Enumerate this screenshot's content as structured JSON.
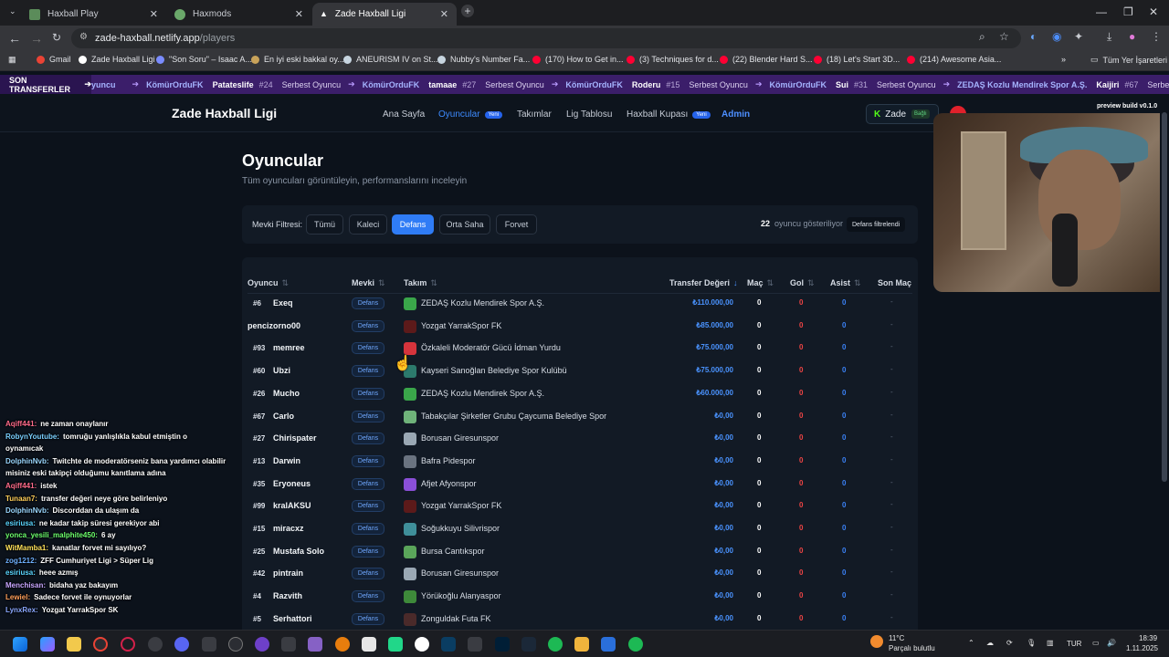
{
  "browser": {
    "tabs": [
      {
        "title": "Haxball Play",
        "active": false
      },
      {
        "title": "Haxmods",
        "active": false
      },
      {
        "title": "Zade Haxball Ligi",
        "active": true
      }
    ],
    "url_host": "zade-haxball.netlify.app",
    "url_path": "/players",
    "bookmarks": [
      "Gmail",
      "Zade Haxball Ligi",
      "\"Son Soru\" – Isaac A...",
      "En iyi eski bakkal oy...",
      "ANEURISM IV on St...",
      "Nubby's Number Fa...",
      "(170) How to Get in...",
      "(3) Techniques for d...",
      "(22) Blender Hard S...",
      "(18) Let's Start 3D...",
      "(214) Awesome Asia..."
    ],
    "all_bookmarks": "Tüm Yer İşaretleri"
  },
  "ticker": {
    "label": "SON TRANSFERLER",
    "items": [
      {
        "from": "",
        "to": "yuncu",
        "player": "",
        "num": ""
      },
      {
        "from": "",
        "to": "KömürOrduFK",
        "player": "Patateslife",
        "num": "#24"
      },
      {
        "from": "Serbest Oyuncu",
        "to": "KömürOrduFK",
        "player": "tamaae",
        "num": "#27"
      },
      {
        "from": "Serbest Oyuncu",
        "to": "KömürOrduFK",
        "player": "Roderu",
        "num": "#15"
      },
      {
        "from": "Serbest Oyuncu",
        "to": "KömürOrduFK",
        "player": "Sui",
        "num": "#31"
      },
      {
        "from": "Serbest Oyuncu",
        "to": "ZEDAŞ Kozlu Mendirek Spor A.Ş.",
        "player": "Kaijiri",
        "num": "#67"
      },
      {
        "from": "Serbest O",
        "to": "",
        "player": "",
        "num": ""
      }
    ]
  },
  "header": {
    "logo": "Zade Haxball Ligi",
    "nav": [
      {
        "label": "Ana Sayfa",
        "badge": ""
      },
      {
        "label": "Oyuncular",
        "badge": "Yeni"
      },
      {
        "label": "Takımlar",
        "badge": ""
      },
      {
        "label": "Lig Tablosu",
        "badge": ""
      },
      {
        "label": "Haxball Kupası",
        "badge": "Yeni"
      },
      {
        "label": "Admin",
        "badge": ""
      }
    ],
    "user": "Zade",
    "user_status": "Bağlı",
    "kick_glyph": "K",
    "preview": "preview build v0.1.0"
  },
  "page": {
    "title": "Oyuncular",
    "subtitle": "Tüm oyuncuları görüntüleyin, performanslarını inceleyin",
    "filter_label": "Mevki Filtresi:",
    "filters": [
      "Tümü",
      "Kaleci",
      "Defans",
      "Orta Saha",
      "Forvet"
    ],
    "active_filter": "Defans",
    "count": "22",
    "count_text": "oyuncu gösteriliyor",
    "filtered_badge": "Defans filtrelendi"
  },
  "table": {
    "columns": [
      "Oyuncu",
      "Mevki",
      "Takım",
      "Transfer Değeri",
      "Maç",
      "Gol",
      "Asist",
      "Son Maç"
    ],
    "rows": [
      {
        "no": "#6",
        "name": "Exeq",
        "pos": "Defans",
        "team": "ZEDAŞ Kozlu Mendirek Spor A.Ş.",
        "color": "#3aa64a",
        "value": "₺110.000,00",
        "mac": "0",
        "gol": "0",
        "asist": "0",
        "son": "-"
      },
      {
        "no": "",
        "name": "pencizorno00",
        "pos": "Defans",
        "team": "Yozgat YarrakSpor FK",
        "color": "#5c1a1a",
        "value": "₺85.000,00",
        "mac": "0",
        "gol": "0",
        "asist": "0",
        "son": "-"
      },
      {
        "no": "#93",
        "name": "memree",
        "pos": "Defans",
        "team": "Özkaleli Moderatör Gücü İdman Yurdu",
        "color": "#d6343c",
        "value": "₺75.000,00",
        "mac": "0",
        "gol": "0",
        "asist": "0",
        "son": "-"
      },
      {
        "no": "#60",
        "name": "Ubzi",
        "pos": "Defans",
        "team": "Kayseri Sanoğlan Belediye Spor Kulübü",
        "color": "#2c7a6c",
        "value": "₺75.000,00",
        "mac": "0",
        "gol": "0",
        "asist": "0",
        "son": "-"
      },
      {
        "no": "#26",
        "name": "Mucho",
        "pos": "Defans",
        "team": "ZEDAŞ Kozlu Mendirek Spor A.Ş.",
        "color": "#3aa64a",
        "value": "₺60.000,00",
        "mac": "0",
        "gol": "0",
        "asist": "0",
        "son": "-"
      },
      {
        "no": "#67",
        "name": "Carlo",
        "pos": "Defans",
        "team": "Tabakçılar Şirketler Grubu Çaycuma Belediye Spor",
        "color": "#6fb37a",
        "value": "₺0,00",
        "mac": "0",
        "gol": "0",
        "asist": "0",
        "son": "-"
      },
      {
        "no": "#27",
        "name": "Chirispater",
        "pos": "Defans",
        "team": "Borusan Giresunspor",
        "color": "#9aa8b4",
        "value": "₺0,00",
        "mac": "0",
        "gol": "0",
        "asist": "0",
        "son": "-"
      },
      {
        "no": "#13",
        "name": "Darwin",
        "pos": "Defans",
        "team": "Bafra Pidespor",
        "color": "#6a7380",
        "value": "₺0,00",
        "mac": "0",
        "gol": "0",
        "asist": "0",
        "son": "-"
      },
      {
        "no": "#35",
        "name": "Eryoneus",
        "pos": "Defans",
        "team": "Afjet Afyonspor",
        "color": "#8a4fd8",
        "value": "₺0,00",
        "mac": "0",
        "gol": "0",
        "asist": "0",
        "son": "-"
      },
      {
        "no": "#99",
        "name": "kralAKSU",
        "pos": "Defans",
        "team": "Yozgat YarrakSpor FK",
        "color": "#5c1a1a",
        "value": "₺0,00",
        "mac": "0",
        "gol": "0",
        "asist": "0",
        "son": "-"
      },
      {
        "no": "#15",
        "name": "miracxz",
        "pos": "Defans",
        "team": "Soğukkuyu Silivrispor",
        "color": "#3f8f9a",
        "value": "₺0,00",
        "mac": "0",
        "gol": "0",
        "asist": "0",
        "son": "-"
      },
      {
        "no": "#25",
        "name": "Mustafa Solo",
        "pos": "Defans",
        "team": "Bursa Cantıkspor",
        "color": "#5aa55a",
        "value": "₺0,00",
        "mac": "0",
        "gol": "0",
        "asist": "0",
        "son": "-"
      },
      {
        "no": "#42",
        "name": "pintrain",
        "pos": "Defans",
        "team": "Borusan Giresunspor",
        "color": "#9aa8b4",
        "value": "₺0,00",
        "mac": "0",
        "gol": "0",
        "asist": "0",
        "son": "-"
      },
      {
        "no": "#4",
        "name": "Razvith",
        "pos": "Defans",
        "team": "Yörükoğlu Alanyaspor",
        "color": "#3e8a3a",
        "value": "₺0,00",
        "mac": "0",
        "gol": "0",
        "asist": "0",
        "son": "-"
      },
      {
        "no": "#5",
        "name": "Serhattori",
        "pos": "Defans",
        "team": "Zonguldak Futa FK",
        "color": "#4a2a2a",
        "value": "₺0,00",
        "mac": "0",
        "gol": "0",
        "asist": "0",
        "son": "-"
      }
    ]
  },
  "chat": [
    {
      "user": "Aqiff441:",
      "msg": "ne zaman onaylanır",
      "color": "#ff6b8a"
    },
    {
      "user": "RobynYoutube:",
      "msg": "tomruğu yanlışlıkla kabul etmiştin o",
      "color": "#7ad0ff"
    },
    {
      "user": "",
      "msg": "oynamıcak",
      "color": "#ffffff"
    },
    {
      "user": "DolphinNvb:",
      "msg": "Twitchte de moderatörseniz bana yardımcı olabilir",
      "color": "#9ad7ff"
    },
    {
      "user": "",
      "msg": "misiniz eski takipçi olduğumu kanıtlama adına",
      "color": "#ffffff"
    },
    {
      "user": "Aqiff441:",
      "msg": "istek",
      "color": "#ff6b8a"
    },
    {
      "user": "Tunaan7:",
      "msg": "transfer değeri neye göre belirleniyo",
      "color": "#ffcf5a"
    },
    {
      "user": "DolphinNvb:",
      "msg": "Discorddan da ulaşım da",
      "color": "#9ad7ff"
    },
    {
      "user": "esiriusa:",
      "msg": "ne kadar takip süresi gerekiyor abi",
      "color": "#5ad6ff"
    },
    {
      "user": "yonca_yesili_malphite450:",
      "msg": "6 ay",
      "color": "#6dff6d"
    },
    {
      "user": "WitMamba1:",
      "msg": "kanatlar forvet mi sayılıyo?",
      "color": "#ffe15a"
    },
    {
      "user": "zog1212:",
      "msg": "ZFF Cumhuriyet Ligi > Süper Lig",
      "color": "#6fb1ff"
    },
    {
      "user": "esiriusa:",
      "msg": "heee azmış",
      "color": "#5ad6ff"
    },
    {
      "user": "Menchisan:",
      "msg": "bidaha yaz bakayım",
      "color": "#c8a6ff"
    },
    {
      "user": "Lewiel:",
      "msg": "Sadece forvet ile oynuyorlar",
      "color": "#ff9f5a"
    },
    {
      "user": "LynxRex:",
      "msg": "Yozgat YarrakSpor SK",
      "color": "#8aa8ff"
    }
  ],
  "taskbar": {
    "weather_temp": "11°C",
    "weather_desc": "Parçalı bulutlu",
    "lang": "TUR",
    "time": "18:39",
    "date": "1.11.2025"
  }
}
